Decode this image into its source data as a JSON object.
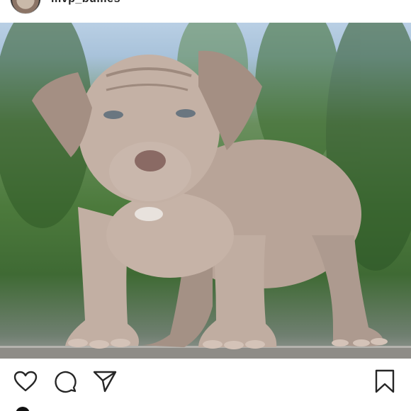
{
  "header": {
    "username": "mvp_bullies",
    "avatar_icon": "profile-avatar-icon"
  },
  "photo": {
    "alt": ""
  },
  "actions": {
    "like_icon": "heart-icon",
    "comment_icon": "comment-icon",
    "share_icon": "send-icon",
    "save_icon": "bookmark-icon"
  },
  "colors": {
    "icon_stroke": "#262626",
    "background": "#ffffff"
  }
}
